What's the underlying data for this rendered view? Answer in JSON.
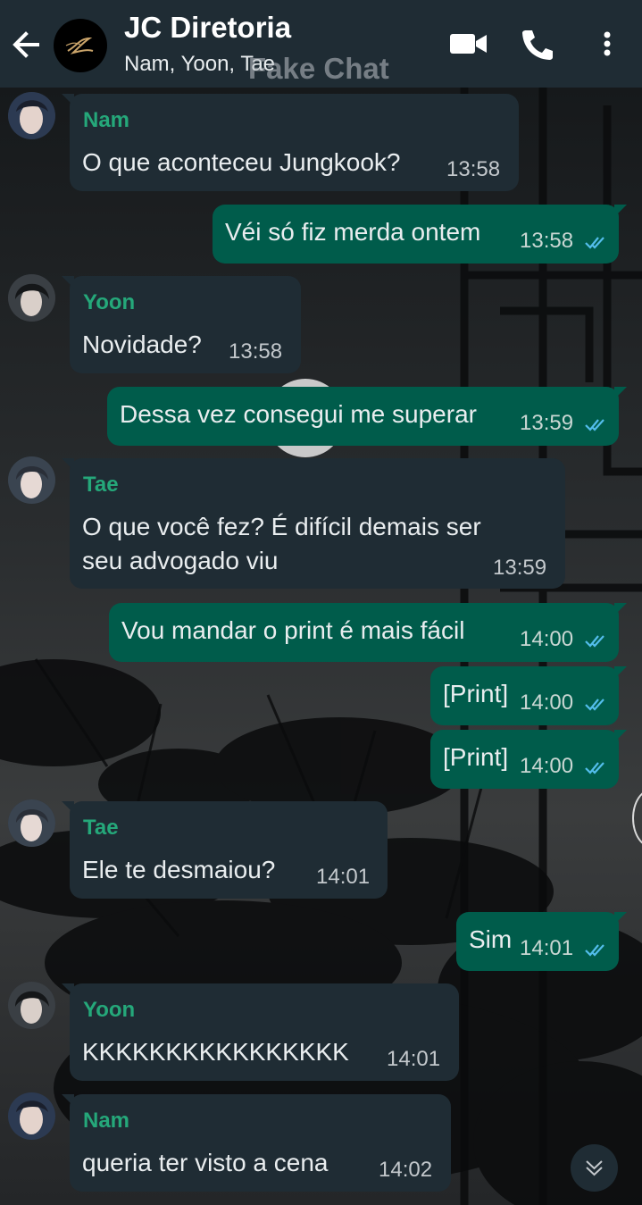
{
  "header": {
    "title": "JC Diretoria",
    "subtitle": "Nam, Yoon, Tae",
    "watermark": "Fake Chat",
    "back_icon": "arrow-left-icon",
    "video_icon": "video-camera-icon",
    "call_icon": "phone-icon",
    "menu_icon": "more-vertical-icon"
  },
  "colors": {
    "header_bg": "#1f2c34",
    "incoming_bubble": "#1f2c34",
    "outgoing_bubble": "#005c4b",
    "read_ticks": "#53bdeb",
    "name_nam": "#25a87a",
    "name_yoon": "#25a87a",
    "name_tae": "#25a87a"
  },
  "messages": [
    {
      "direction": "in",
      "sender": "Nam",
      "lines": [
        "O que aconteceu Jungkook?"
      ],
      "time": "13:58"
    },
    {
      "direction": "out",
      "lines": [
        "Véi só fiz merda ontem"
      ],
      "time": "13:58",
      "status": "read"
    },
    {
      "direction": "in",
      "sender": "Yoon",
      "lines": [
        "Novidade?"
      ],
      "time": "13:58"
    },
    {
      "direction": "out",
      "lines": [
        "Dessa vez consegui me superar"
      ],
      "time": "13:59",
      "status": "read"
    },
    {
      "direction": "in",
      "sender": "Tae",
      "lines": [
        "O que você fez? É difícil demais ser",
        "seu advogado viu"
      ],
      "time": "13:59"
    },
    {
      "direction": "out",
      "lines": [
        "Vou mandar o print é mais fácil"
      ],
      "time": "14:00",
      "status": "read"
    },
    {
      "direction": "out",
      "lines": [
        "[Print]"
      ],
      "time": "14:00",
      "status": "read"
    },
    {
      "direction": "out",
      "lines": [
        "[Print]"
      ],
      "time": "14:00",
      "status": "read"
    },
    {
      "direction": "in",
      "sender": "Tae",
      "lines": [
        "Ele te desmaiou?"
      ],
      "time": "14:01"
    },
    {
      "direction": "out",
      "lines": [
        "Sim"
      ],
      "time": "14:01",
      "status": "read"
    },
    {
      "direction": "in",
      "sender": "Yoon",
      "lines": [
        "KKKKKKKKKKKKKKKK"
      ],
      "time": "14:01"
    },
    {
      "direction": "in",
      "sender": "Nam",
      "lines": [
        "queria ter visto a cena"
      ],
      "time": "14:02"
    }
  ],
  "scroll_button_icon": "chevrons-down-icon"
}
